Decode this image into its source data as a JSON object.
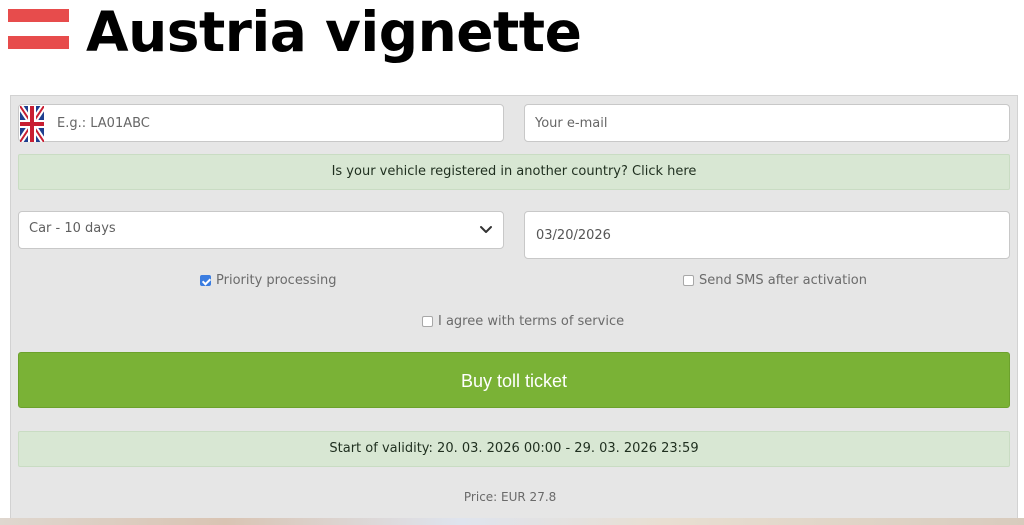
{
  "header": {
    "title": "Austria vignette",
    "flag_colors": [
      "#e74c4c",
      "#ffffff",
      "#e74c4c"
    ]
  },
  "form": {
    "plate": {
      "placeholder": "E.g.: LA01ABC",
      "flag_icon": "uk-flag-icon"
    },
    "email": {
      "placeholder": "Your e-mail"
    },
    "country_notice": "Is your vehicle registered in another country? Click here",
    "duration": {
      "selected": "Car - 10 days",
      "icon": "chevron-down-icon"
    },
    "date": {
      "value": "03/20/2026"
    },
    "checkboxes": {
      "priority": {
        "label": "Priority processing",
        "checked": true
      },
      "sms": {
        "label": "Send SMS after activation",
        "checked": false
      },
      "terms": {
        "label": "I agree with terms of service",
        "checked": false
      }
    },
    "buy_button": "Buy toll ticket",
    "validity": "Start of validity: 20. 03. 2026 00:00 - 29. 03. 2026 23:59",
    "price": "Price: EUR 27.8 ￼"
  },
  "colors": {
    "panel_background": "#e6e6e6",
    "notice_background": "#d8e7d3",
    "button_background": "#7ab236",
    "checkbox_checked": "#3b7de0"
  }
}
